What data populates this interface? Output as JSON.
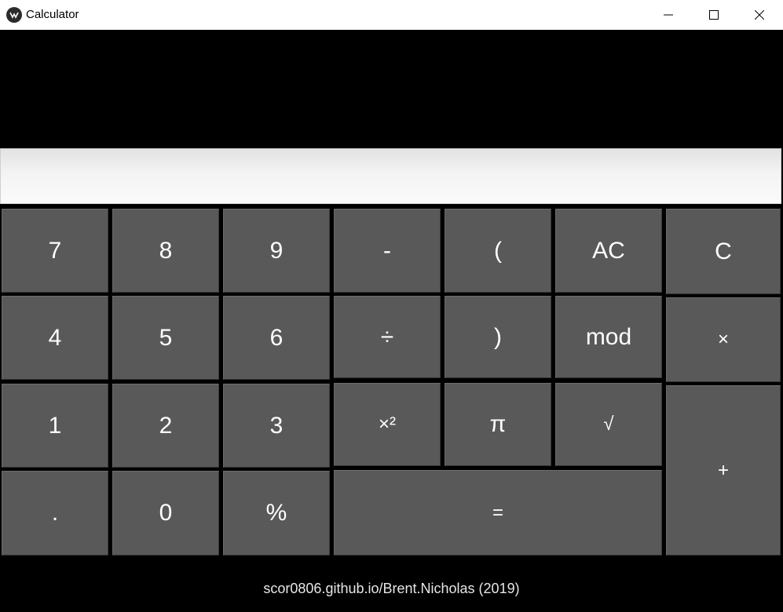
{
  "window": {
    "title": "Calculator"
  },
  "display": {
    "value": ""
  },
  "keys": {
    "seven": "7",
    "eight": "8",
    "nine": "9",
    "minus": "-",
    "lparen": "(",
    "ac": "AC",
    "c": "C",
    "four": "4",
    "five": "5",
    "six": "6",
    "divide": "÷",
    "rparen": ")",
    "mod": "mod",
    "multiply": "×",
    "one": "1",
    "two": "2",
    "three": "3",
    "square": "×²",
    "pi": "π",
    "sqrt": "√",
    "plus": "+",
    "dot": ".",
    "zero": "0",
    "percent": "%",
    "equals": "="
  },
  "footer": {
    "credit": "scor0806.github.io/Brent.Nicholas (2019)"
  },
  "colors": {
    "key_bg": "#595959",
    "background": "#000000",
    "titlebar": "#ffffff"
  }
}
